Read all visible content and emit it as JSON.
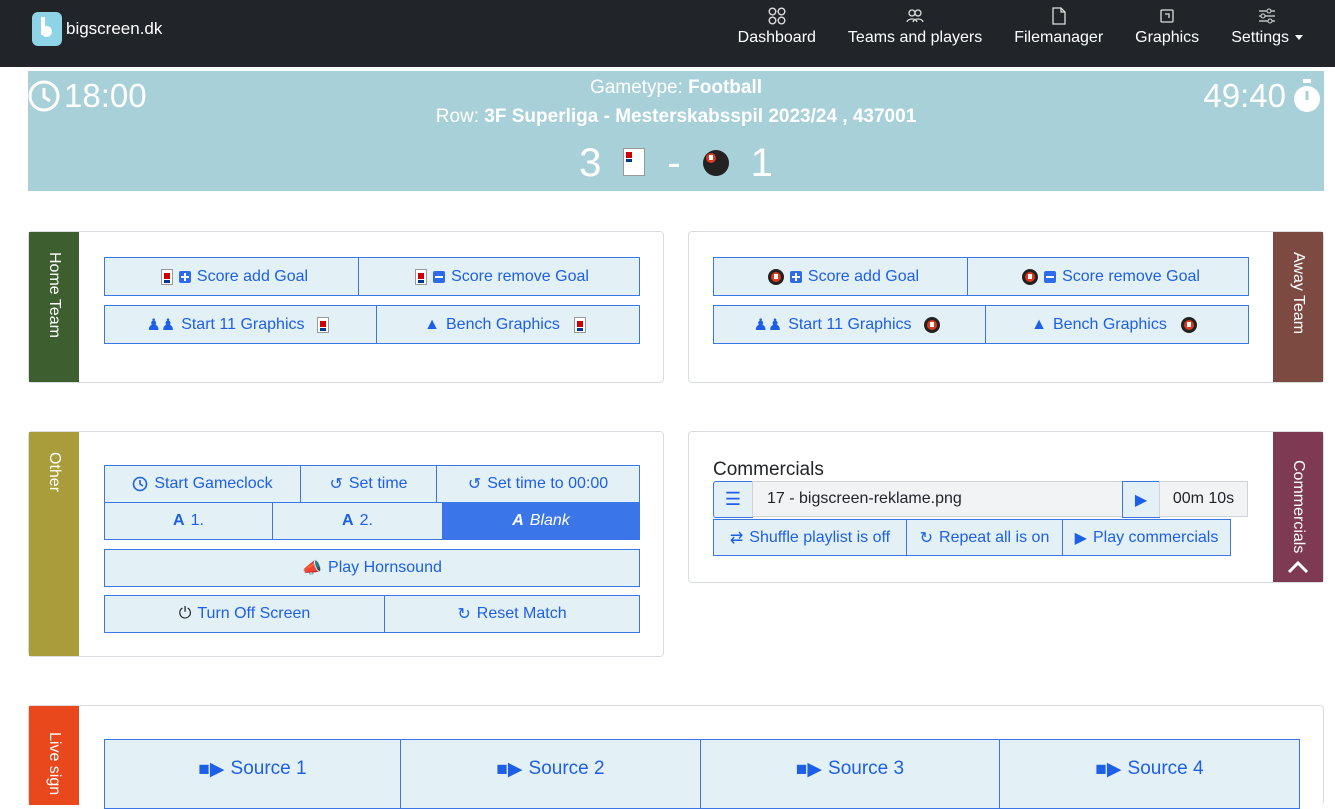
{
  "brand": {
    "name": "bigscreen.dk"
  },
  "nav": {
    "dashboard": "Dashboard",
    "teams": "Teams and players",
    "files": "Filemanager",
    "graphics": "Graphics",
    "settings": "Settings"
  },
  "scoreboard": {
    "time": "18:00",
    "gametype_label": "Gametype:",
    "gametype": "Football",
    "row_label": "Row:",
    "row": "3F Superliga - Mesterskabsspil 2023/24 , 437001",
    "home_score": "3",
    "separator": "-",
    "away_score": "1",
    "timer": "49:40"
  },
  "home": {
    "label": "Home Team",
    "add_goal": "Score add Goal",
    "remove_goal": "Score remove Goal",
    "start11": "Start 11 Graphics",
    "bench": "Bench Graphics",
    "color": "#3d5e2f"
  },
  "away": {
    "label": "Away Team",
    "add_goal": "Score add Goal",
    "remove_goal": "Score remove Goal",
    "start11": "Start 11 Graphics",
    "bench": "Bench Graphics",
    "color": "#7d4a41"
  },
  "other": {
    "label": "Other",
    "start_clock": "Start Gameclock",
    "set_time": "Set time",
    "set_zero": "Set time to 00:00",
    "half1": "1.",
    "half2": "2.",
    "blank": "Blank",
    "horn": "Play Hornsound",
    "off": "Turn Off Screen",
    "reset": "Reset Match",
    "color": "#a89d3a"
  },
  "commercials": {
    "label": "Commercials",
    "title": "Commercials",
    "file": "17 - bigscreen-reklame.png",
    "duration": "00m 10s",
    "shuffle": "Shuffle playlist is off",
    "repeat": "Repeat all is on",
    "play": "Play commercials",
    "color": "#7d3a52"
  },
  "live": {
    "label": "Live sign",
    "sources": [
      "Source 1",
      "Source 2",
      "Source 3",
      "Source 4"
    ],
    "color": "#e8481c"
  }
}
